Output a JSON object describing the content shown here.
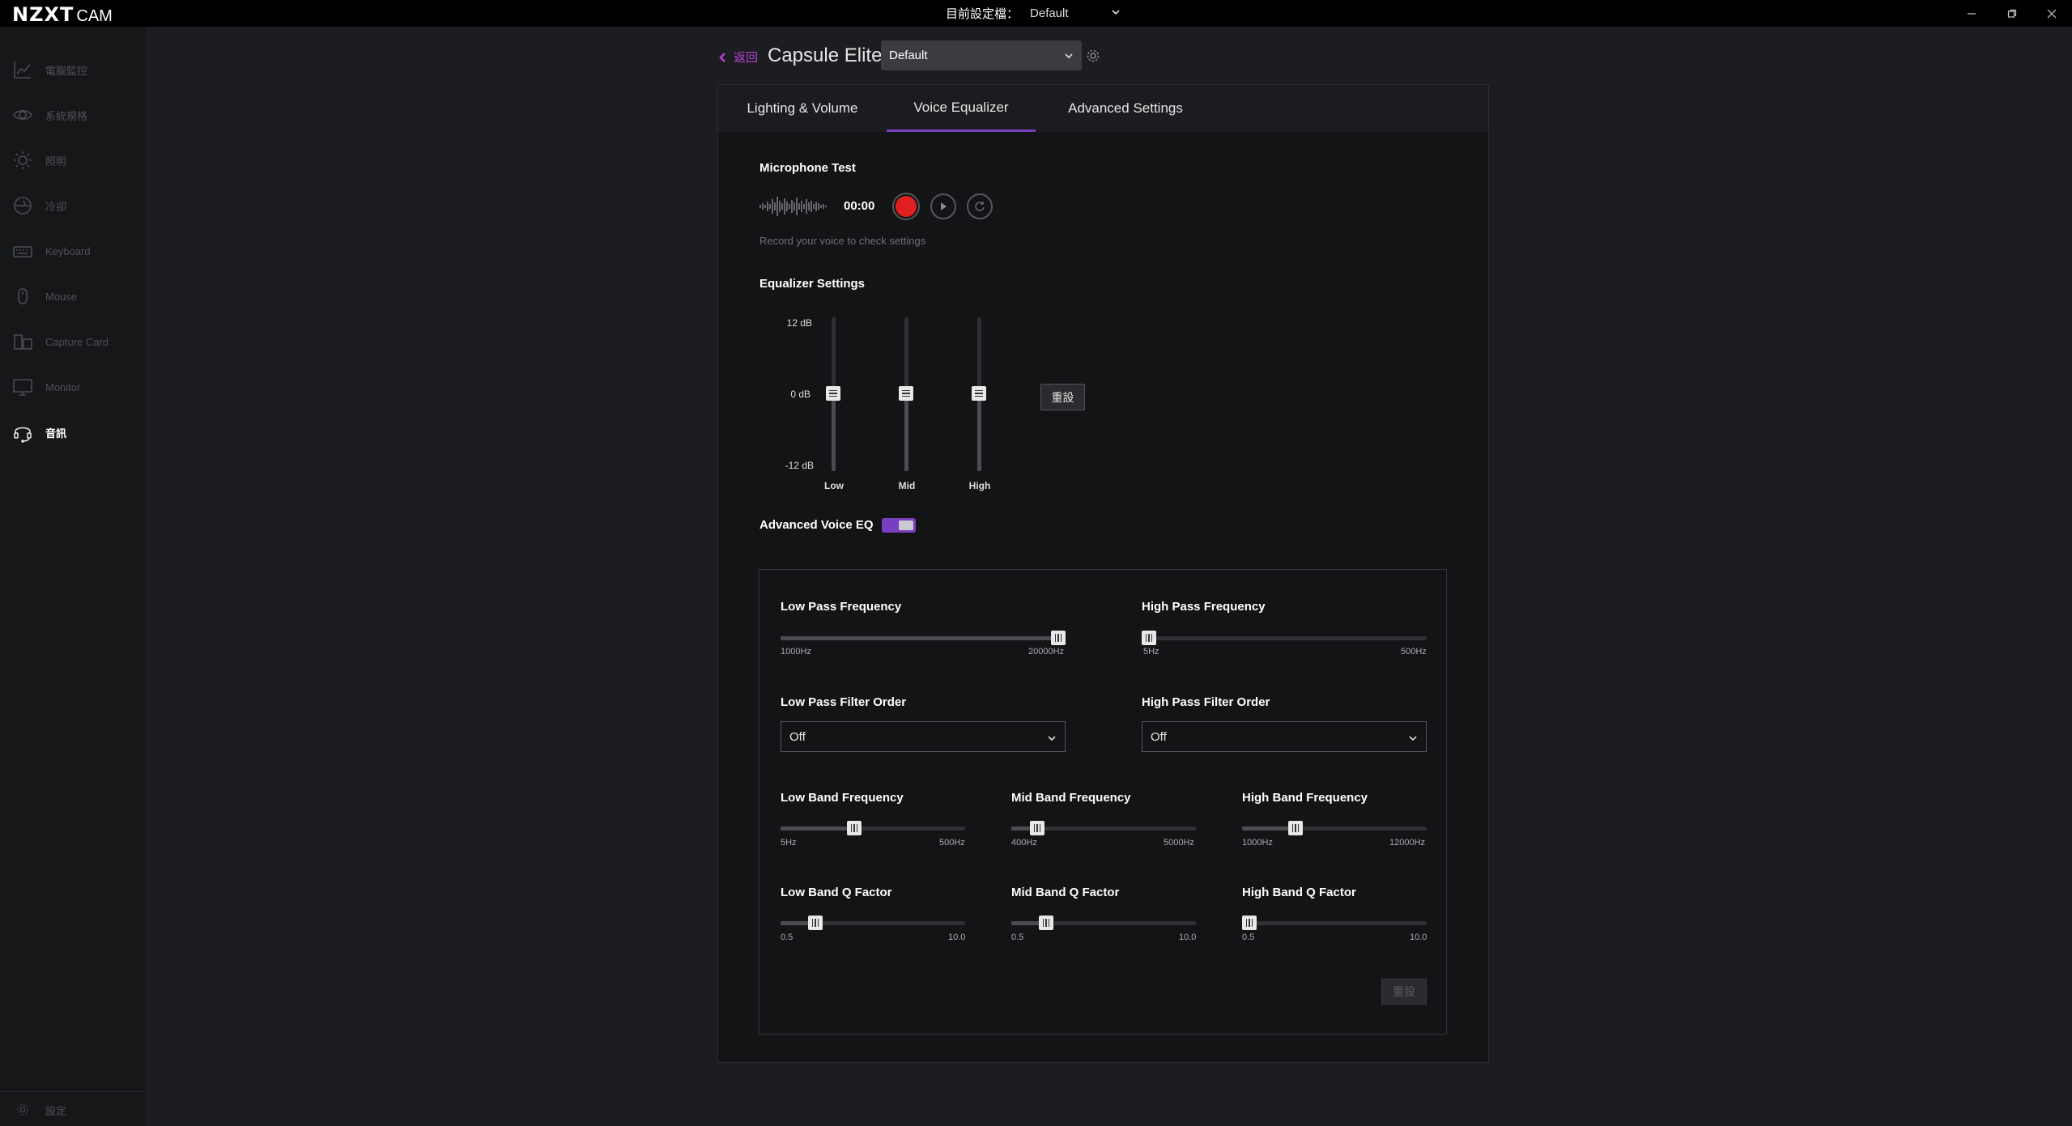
{
  "app": {
    "brand": "NZXT",
    "brand_suffix": "CAM"
  },
  "titlebar": {
    "profile_label": "目前設定檔：",
    "profile_value": "Default"
  },
  "sidebar": {
    "items": [
      {
        "label": "電腦監控",
        "icon": "chart-line-icon"
      },
      {
        "label": "系統規格",
        "icon": "eye-icon"
      },
      {
        "label": "照明",
        "icon": "sun-icon"
      },
      {
        "label": "冷卻",
        "icon": "fan-icon"
      },
      {
        "label": "Keyboard",
        "icon": "keyboard-icon"
      },
      {
        "label": "Mouse",
        "icon": "mouse-icon"
      },
      {
        "label": "Capture Card",
        "icon": "capture-card-icon"
      },
      {
        "label": "Monitor",
        "icon": "monitor-icon"
      },
      {
        "label": "音訊",
        "icon": "headset-icon"
      }
    ],
    "settings_label": "設定"
  },
  "header": {
    "back_label": "返回",
    "device_title": "Capsule Elite",
    "device_profile": "Default"
  },
  "tabs": [
    "Lighting & Volume",
    "Voice Equalizer",
    "Advanced Settings"
  ],
  "mic_test": {
    "title": "Microphone Test",
    "timer": "00:00",
    "hint": "Record your voice to check settings"
  },
  "eq": {
    "title": "Equalizer Settings",
    "scale": [
      "12 dB",
      "0 dB",
      "-12 dB"
    ],
    "bands": [
      {
        "name": "Low",
        "value_db": 0
      },
      {
        "name": "Mid",
        "value_db": 0
      },
      {
        "name": "High",
        "value_db": 0
      }
    ],
    "reset_label": "重設"
  },
  "advanced_voice_eq": {
    "label": "Advanced Voice EQ",
    "enabled": true
  },
  "advanced": {
    "low_pass_freq": {
      "label": "Low Pass Frequency",
      "min": "1000Hz",
      "max": "20000Hz",
      "value": 1.0
    },
    "high_pass_freq": {
      "label": "High Pass Frequency",
      "min": "5Hz",
      "max": "500Hz",
      "value": 0.0
    },
    "low_pass_order": {
      "label": "Low Pass Filter Order",
      "value": "Off"
    },
    "high_pass_order": {
      "label": "High Pass Filter Order",
      "value": "Off"
    },
    "low_band_freq": {
      "label": "Low Band Frequency",
      "min": "5Hz",
      "max": "500Hz",
      "value": 0.39
    },
    "mid_band_freq": {
      "label": "Mid Band Frequency",
      "min": "400Hz",
      "max": "5000Hz",
      "value": 0.11
    },
    "high_band_freq": {
      "label": "High Band Frequency",
      "min": "1000Hz",
      "max": "12000Hz",
      "value": 0.27
    },
    "low_band_q": {
      "label": "Low Band Q Factor",
      "min": "0.5",
      "max": "10.0",
      "value": 0.16
    },
    "mid_band_q": {
      "label": "Mid Band Q Factor",
      "min": "0.5",
      "max": "10.0",
      "value": 0.16
    },
    "high_band_q": {
      "label": "High Band Q Factor",
      "min": "0.5",
      "max": "10.0",
      "value": 0.0
    },
    "reset_label": "重設"
  },
  "colors": {
    "accent": "#7a3fc0",
    "back_link": "#b640d6",
    "record": "#e02020"
  }
}
